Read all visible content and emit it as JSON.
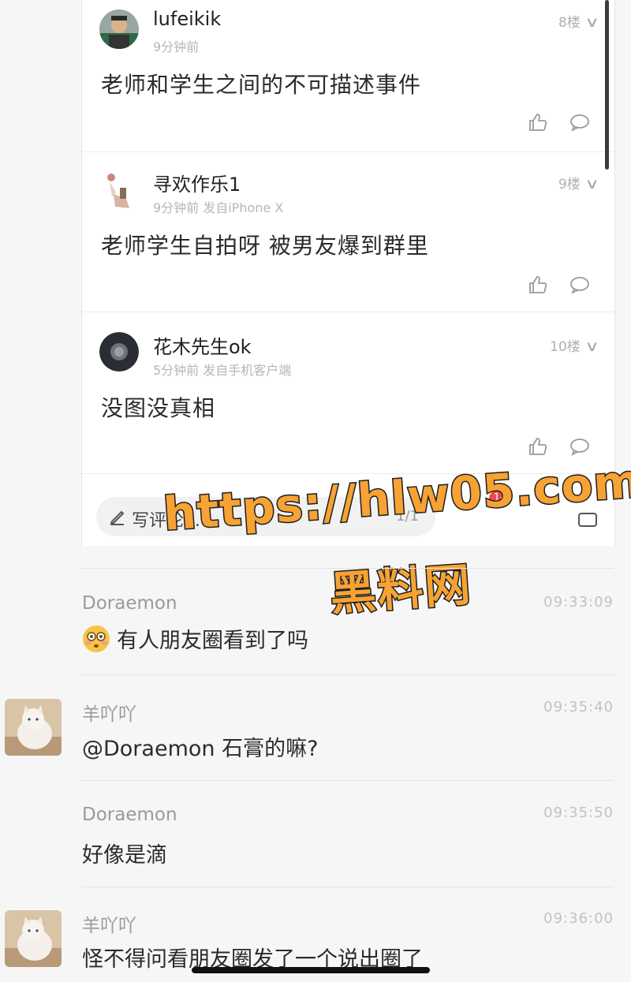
{
  "posts": [
    {
      "name": "lufeikik",
      "meta": "9分钟前",
      "floor": "8楼",
      "text": "老师和学生之间的不可描述事件"
    },
    {
      "name": "寻欢作乐1",
      "meta": "9分钟前 发自iPhone X",
      "floor": "9楼",
      "text": "老师学生自拍呀 被男友爆到群里"
    },
    {
      "name": "花木先生ok",
      "meta": "5分钟前 发自手机客户端",
      "floor": "10楼",
      "text": "没图没真相"
    }
  ],
  "comment_bar": {
    "placeholder": "写评论...",
    "page": "1/1",
    "badge": "14"
  },
  "watermark": {
    "url": "https://hlw05.com",
    "name": "黑料网"
  },
  "chat": [
    {
      "name": "Doraemon",
      "time": "09:33:09",
      "text": "有人朋友圈看到了吗"
    },
    {
      "name": "羊吖吖",
      "time": "09:35:40",
      "text": "@Doraemon 石膏的嘛?"
    },
    {
      "name": "Doraemon",
      "time": "09:35:50",
      "text": "好像是滴"
    },
    {
      "name": "羊吖吖",
      "time": "09:36:00",
      "text": "怪不得问看朋友圈发了一个说出圈了"
    }
  ],
  "icons": {
    "like": "thumbs-up-icon",
    "reply": "speech-bubble-icon",
    "chevron": "chevron-down-icon",
    "pen": "pencil-icon",
    "share": "share-icon",
    "emoji": "flushed-face-emoji"
  },
  "colors": {
    "watermark": "#f7a234",
    "badge": "#f04848"
  }
}
